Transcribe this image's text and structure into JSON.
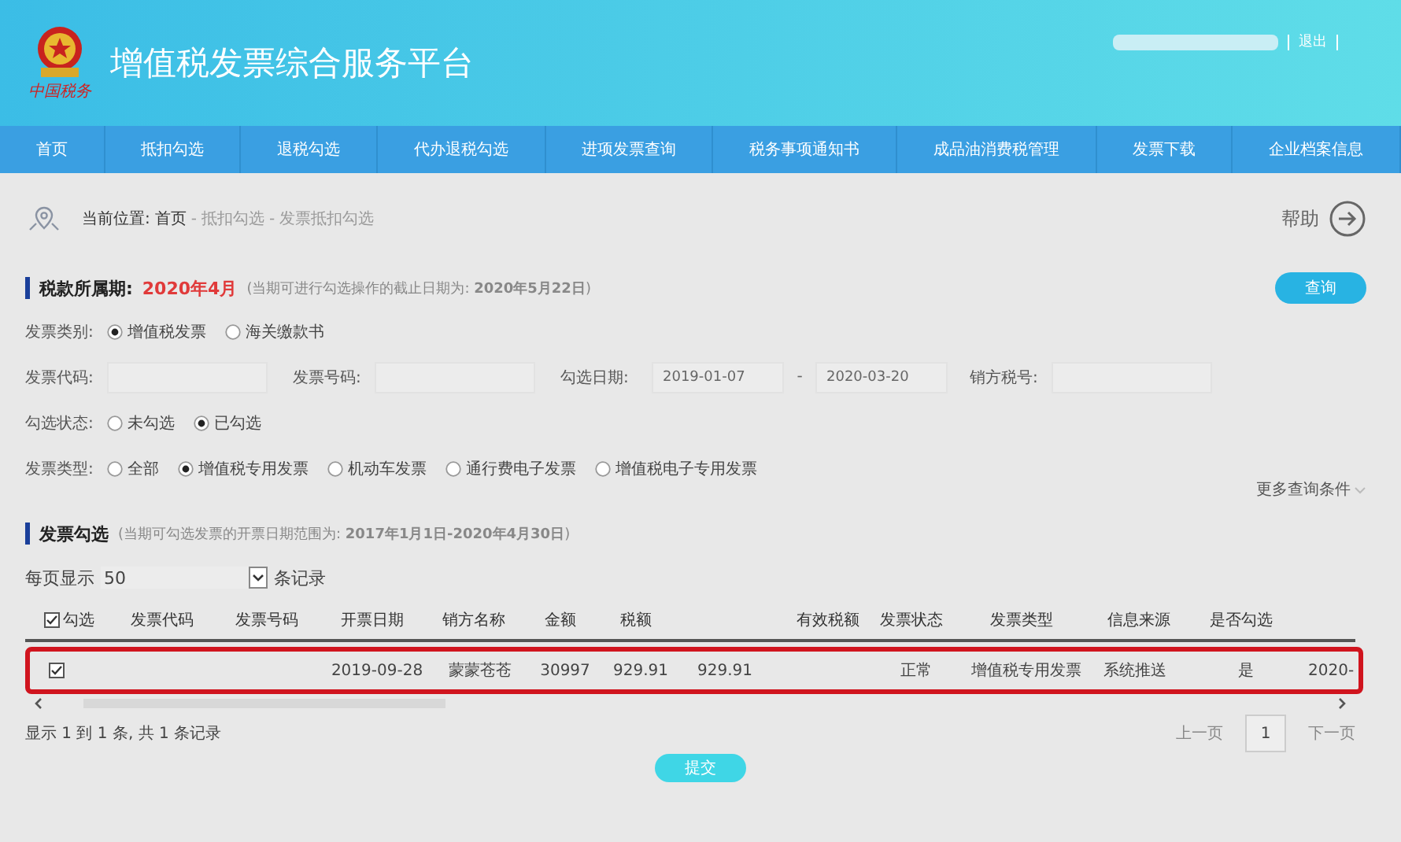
{
  "header": {
    "title": "增值税发票综合服务平台",
    "logo_text": "中国税务",
    "logout": "退出"
  },
  "nav": [
    {
      "label": "首页",
      "selected": false
    },
    {
      "label": "抵扣勾选",
      "selected": false
    },
    {
      "label": "退税勾选",
      "selected": false
    },
    {
      "label": "代办退税勾选",
      "selected": false
    },
    {
      "label": "进项发票查询",
      "selected": false
    },
    {
      "label": "税务事项通知书",
      "selected": false
    },
    {
      "label": "成品油消费税管理",
      "selected": false
    },
    {
      "label": "发票下载",
      "selected": false
    },
    {
      "label": "企业档案信息",
      "selected": false
    }
  ],
  "breadcrumb": {
    "label": "当前位置:",
    "items": [
      "首页",
      "抵扣勾选",
      "发票抵扣勾选"
    ],
    "separator": "-",
    "help": "帮助"
  },
  "period": {
    "label": "税款所属期:",
    "value": "2020年4月",
    "note_prefix": "(当期可进行勾选操作的截止日期为: ",
    "note_date": "2020年5月22日",
    "note_suffix": ")",
    "query_button": "查询"
  },
  "filters": {
    "category": {
      "label": "发票类别:",
      "options": [
        {
          "label": "增值税发票",
          "selected": true
        },
        {
          "label": "海关缴款书",
          "selected": false
        }
      ]
    },
    "code": {
      "label": "发票代码:"
    },
    "number": {
      "label": "发票号码:"
    },
    "date": {
      "label": "勾选日期:",
      "from": "2019-01-07",
      "separator": "-",
      "to": "2020-03-20"
    },
    "seller_tax_id": {
      "label": "销方税号:"
    },
    "status": {
      "label": "勾选状态:",
      "options": [
        {
          "label": "未勾选",
          "selected": false
        },
        {
          "label": "已勾选",
          "selected": true
        }
      ]
    },
    "type": {
      "label": "发票类型:",
      "options": [
        {
          "label": "全部",
          "selected": false
        },
        {
          "label": "增值税专用发票",
          "selected": true
        },
        {
          "label": "机动车发票",
          "selected": false
        },
        {
          "label": "通行费电子发票",
          "selected": false
        },
        {
          "label": "增值税电子专用发票",
          "selected": false
        }
      ]
    },
    "more": "更多查询条件"
  },
  "selection": {
    "title": "发票勾选",
    "note_prefix": "(当期可勾选发票的开票日期范围为: ",
    "note_range": "2017年1月1日-2020年4月30日",
    "note_suffix": ")",
    "page_size_label": "每页显示",
    "page_size": "50",
    "page_size_suffix": "条记录",
    "table": {
      "select_all": {
        "label": "勾选",
        "checked": true
      },
      "columns": [
        "发票代码",
        "发票号码",
        "开票日期",
        "销方名称",
        "金额",
        "税额",
        "有效税额",
        "发票状态",
        "发票类型",
        "信息来源",
        "是否勾选"
      ],
      "rows": [
        {
          "checked": true,
          "highlighted": true,
          "cells": [
            "",
            "",
            "2019-09-28",
            "蒙蒙苍苍",
            "30997",
            "929.91",
            "929.91",
            "正常",
            "增值税专用发票",
            "系统推送",
            "是",
            "2020-"
          ]
        }
      ]
    },
    "summary": "显示 1 到 1 条, 共 1 条记录",
    "pager": {
      "prev": "上一页",
      "page": "1",
      "next": "下一页"
    },
    "submit": "提交"
  }
}
